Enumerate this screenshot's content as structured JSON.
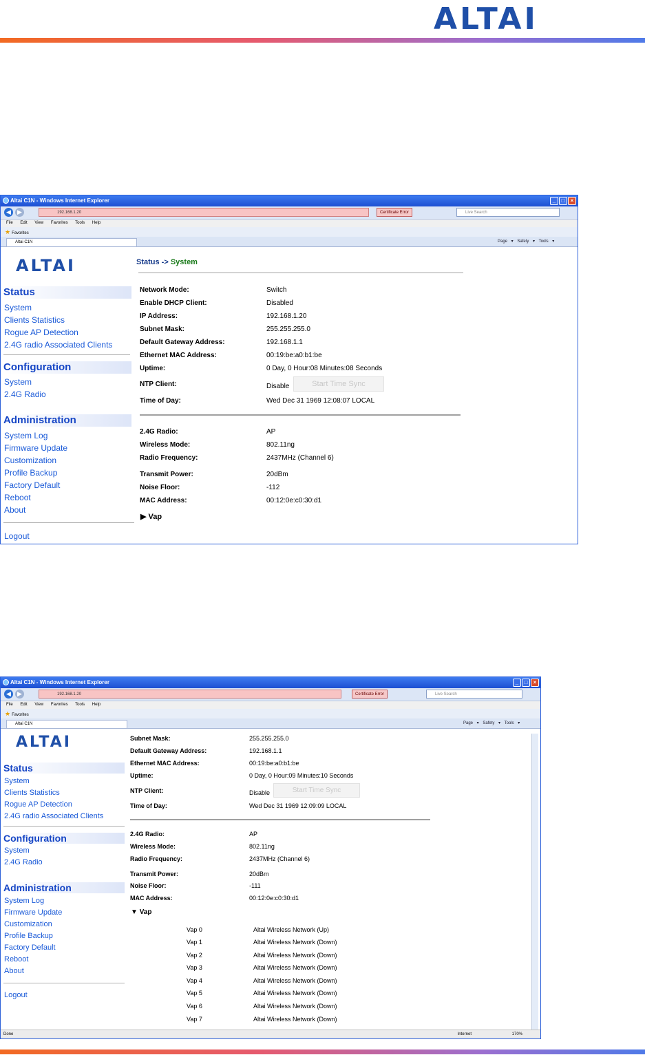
{
  "doc": {
    "logo": "ALTAI"
  },
  "window1": {
    "title": "Altai C1N - Windows Internet Explorer",
    "address": "192.168.1.20",
    "cert_error": "Certificate Error",
    "search_placeholder": "Live Search",
    "menu": "File Edit View Favorites Tools Help",
    "favorites": "Favorites",
    "tab": "Altai C1N",
    "cmdbar": "Page ▾ Safety ▾ Tools ▾",
    "logo": "ALTAI",
    "breadcrumb": {
      "a": "Status",
      "sep": " -> ",
      "b": "System"
    },
    "sidebar": {
      "status": "Status",
      "status_items": [
        "System",
        "Clients Statistics",
        "Rogue AP Detection",
        "2.4G radio Associated Clients"
      ],
      "configuration": "Configuration",
      "config_items": [
        "System",
        "2.4G Radio"
      ],
      "administration": "Administration",
      "admin_items": [
        "System Log",
        "Firmware Update",
        "Customization",
        "Profile Backup",
        "Factory Default",
        "Reboot",
        "About"
      ],
      "logout": "Logout"
    },
    "rows1": [
      {
        "label": "Network Mode:",
        "value": "Switch"
      },
      {
        "label": "Enable DHCP Client:",
        "value": "Disabled"
      },
      {
        "label": "IP Address:",
        "value": "192.168.1.20"
      },
      {
        "label": "Subnet Mask:",
        "value": "255.255.255.0"
      },
      {
        "label": "Default Gateway Address:",
        "value": "192.168.1.1"
      },
      {
        "label": "Ethernet MAC Address:",
        "value": "00:19:be:a0:b1:be"
      },
      {
        "label": "Uptime:",
        "value": "0 Day, 0 Hour:08 Minutes:08 Seconds"
      },
      {
        "label": "NTP Client:",
        "value": "Disable"
      },
      {
        "label": "Time of Day:",
        "value": "Wed Dec 31 1969 12:08:07 LOCAL"
      }
    ],
    "sync_button": "Start Time Sync",
    "rows2": [
      {
        "label": "2.4G Radio:",
        "value": "AP"
      },
      {
        "label": "Wireless Mode:",
        "value": "802.11ng"
      },
      {
        "label": "Radio Frequency:",
        "value": "2437MHz (Channel 6)"
      },
      {
        "label": "Transmit Power:",
        "value": "20dBm"
      },
      {
        "label": "Noise Floor:",
        "value": "-112"
      },
      {
        "label": "MAC Address:",
        "value": "00:12:0e:c0:30:d1"
      }
    ],
    "vap_toggle": "Vap"
  },
  "window2": {
    "title": "Altai C1N - Windows Internet Explorer",
    "address": "192.168.1.20",
    "cert_error": "Certificate Error",
    "search_placeholder": "Live Search",
    "menu": "File Edit View Favorites Tools Help",
    "favorites": "Favorites",
    "tab": "Altai C1N",
    "cmdbar": "Page ▾ Safety ▾ Tools ▾",
    "logo": "ALTAI",
    "sidebar": {
      "status": "Status",
      "status_items": [
        "System",
        "Clients Statistics",
        "Rogue AP Detection",
        "2.4G radio Associated Clients"
      ],
      "configuration": "Configuration",
      "config_items": [
        "System",
        "2.4G Radio"
      ],
      "administration": "Administration",
      "admin_items": [
        "System Log",
        "Firmware Update",
        "Customization",
        "Profile Backup",
        "Factory Default",
        "Reboot",
        "About"
      ],
      "logout": "Logout"
    },
    "rows1": [
      {
        "label": "Subnet Mask:",
        "value": "255.255.255.0"
      },
      {
        "label": "Default Gateway Address:",
        "value": "192.168.1.1"
      },
      {
        "label": "Ethernet MAC Address:",
        "value": "00:19:be:a0:b1:be"
      },
      {
        "label": "Uptime:",
        "value": "0 Day, 0 Hour:09 Minutes:10 Seconds"
      },
      {
        "label": "NTP Client:",
        "value": "Disable"
      },
      {
        "label": "Time of Day:",
        "value": "Wed Dec 31 1969 12:09:09 LOCAL"
      }
    ],
    "sync_button": "Start Time Sync",
    "rows2": [
      {
        "label": "2.4G Radio:",
        "value": "AP"
      },
      {
        "label": "Wireless Mode:",
        "value": "802.11ng"
      },
      {
        "label": "Radio Frequency:",
        "value": "2437MHz (Channel 6)"
      },
      {
        "label": "Transmit Power:",
        "value": "20dBm"
      },
      {
        "label": "Noise Floor:",
        "value": "-111"
      },
      {
        "label": "MAC Address:",
        "value": "00:12:0e:c0:30:d1"
      }
    ],
    "vap_toggle": "Vap",
    "vaps": [
      {
        "name": "Vap 0",
        "value": "Altai Wireless Network (Up)"
      },
      {
        "name": "Vap 1",
        "value": "Altai Wireless Network (Down)"
      },
      {
        "name": "Vap 2",
        "value": "Altai Wireless Network (Down)"
      },
      {
        "name": "Vap 3",
        "value": "Altai Wireless Network (Down)"
      },
      {
        "name": "Vap 4",
        "value": "Altai Wireless Network (Down)"
      },
      {
        "name": "Vap 5",
        "value": "Altai Wireless Network (Down)"
      },
      {
        "name": "Vap 6",
        "value": "Altai Wireless Network (Down)"
      },
      {
        "name": "Vap 7",
        "value": "Altai Wireless Network (Down)"
      }
    ],
    "status_done": "Done",
    "status_zone": "Internet",
    "status_zoom": "170%"
  }
}
